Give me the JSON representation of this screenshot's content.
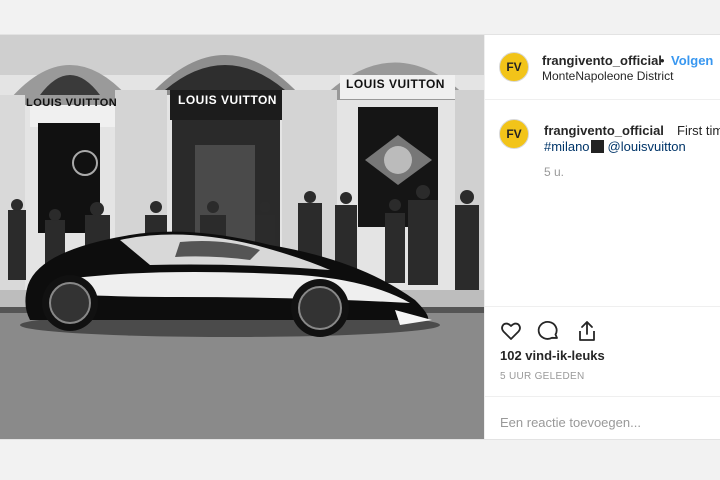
{
  "post": {
    "avatar_initials": "FV",
    "username": "frangivento_official",
    "separator": "•",
    "follow_label": "Volgen",
    "location": "MonteNapoleone District"
  },
  "caption": {
    "username": "frangivento_official",
    "text": "First time",
    "hashtag": "#milano",
    "mention": "@louisvuitton",
    "time": "5 u."
  },
  "photo": {
    "sign_left": "LOUIS VUITTON",
    "sign_center": "LOUIS VUITTON",
    "sign_right": "LOUIS VUITTON"
  },
  "actions": {
    "icons": [
      "heart-icon",
      "comment-icon",
      "share-icon"
    ],
    "likes": "102 vind-ik-leuks",
    "posted": "5 UUR GELEDEN",
    "comment_placeholder": "Een reactie toevoegen..."
  },
  "colors": {
    "link": "#3897f0",
    "hashtag": "#003569",
    "avatar": "#f2c419"
  }
}
